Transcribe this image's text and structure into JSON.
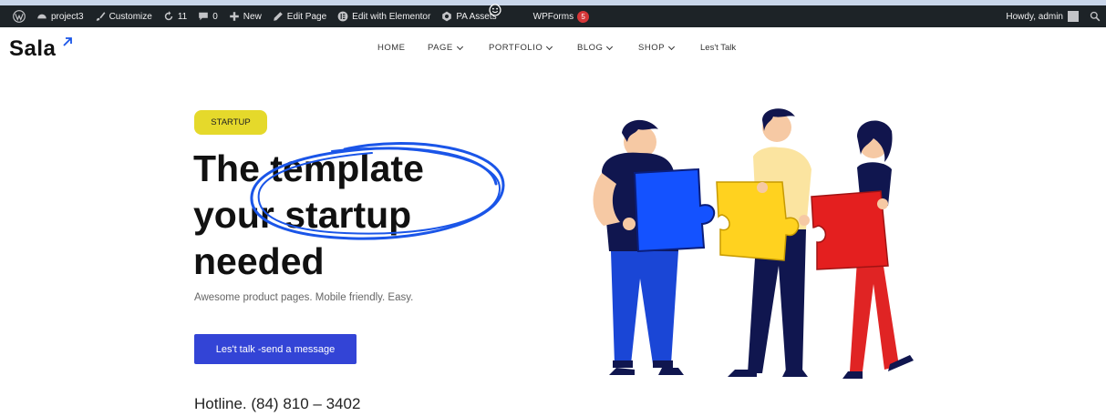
{
  "adminbar": {
    "site_name": "project3",
    "customize": "Customize",
    "updates_count": "11",
    "comments_count": "0",
    "new_label": "New",
    "edit_page": "Edit Page",
    "edit_elementor": "Edit with Elementor",
    "pa_assets": "PA Assets",
    "wpforms": "WPForms",
    "wpforms_badge": "5",
    "howdy": "Howdy, admin"
  },
  "header": {
    "logo": "Sala",
    "nav": [
      {
        "label": "HOME"
      },
      {
        "label": "PAGE"
      },
      {
        "label": "PORTFOLIO"
      },
      {
        "label": "BLOG"
      },
      {
        "label": "SHOP"
      },
      {
        "label": "Les't Talk"
      }
    ]
  },
  "hero": {
    "badge": "STARTUP",
    "headline_1": "The template",
    "headline_2": "your startup",
    "headline_3": "needed",
    "subtitle": "Awesome product pages. Mobile friendly. Easy.",
    "cta": "Les't talk -send a message",
    "hotline": "Hotline. (84) 810 – 3402"
  },
  "colors": {
    "accent_blue": "#3344d6",
    "badge_yellow": "#e5d92b",
    "scribble_blue": "#1a55e8",
    "adminbar_bg": "#1d2327"
  },
  "icons": [
    "wordpress-icon",
    "dashboard-icon",
    "brush-icon",
    "refresh-icon",
    "comment-icon",
    "plus-icon",
    "pencil-icon",
    "elementor-icon",
    "pa-icon",
    "search-icon"
  ]
}
